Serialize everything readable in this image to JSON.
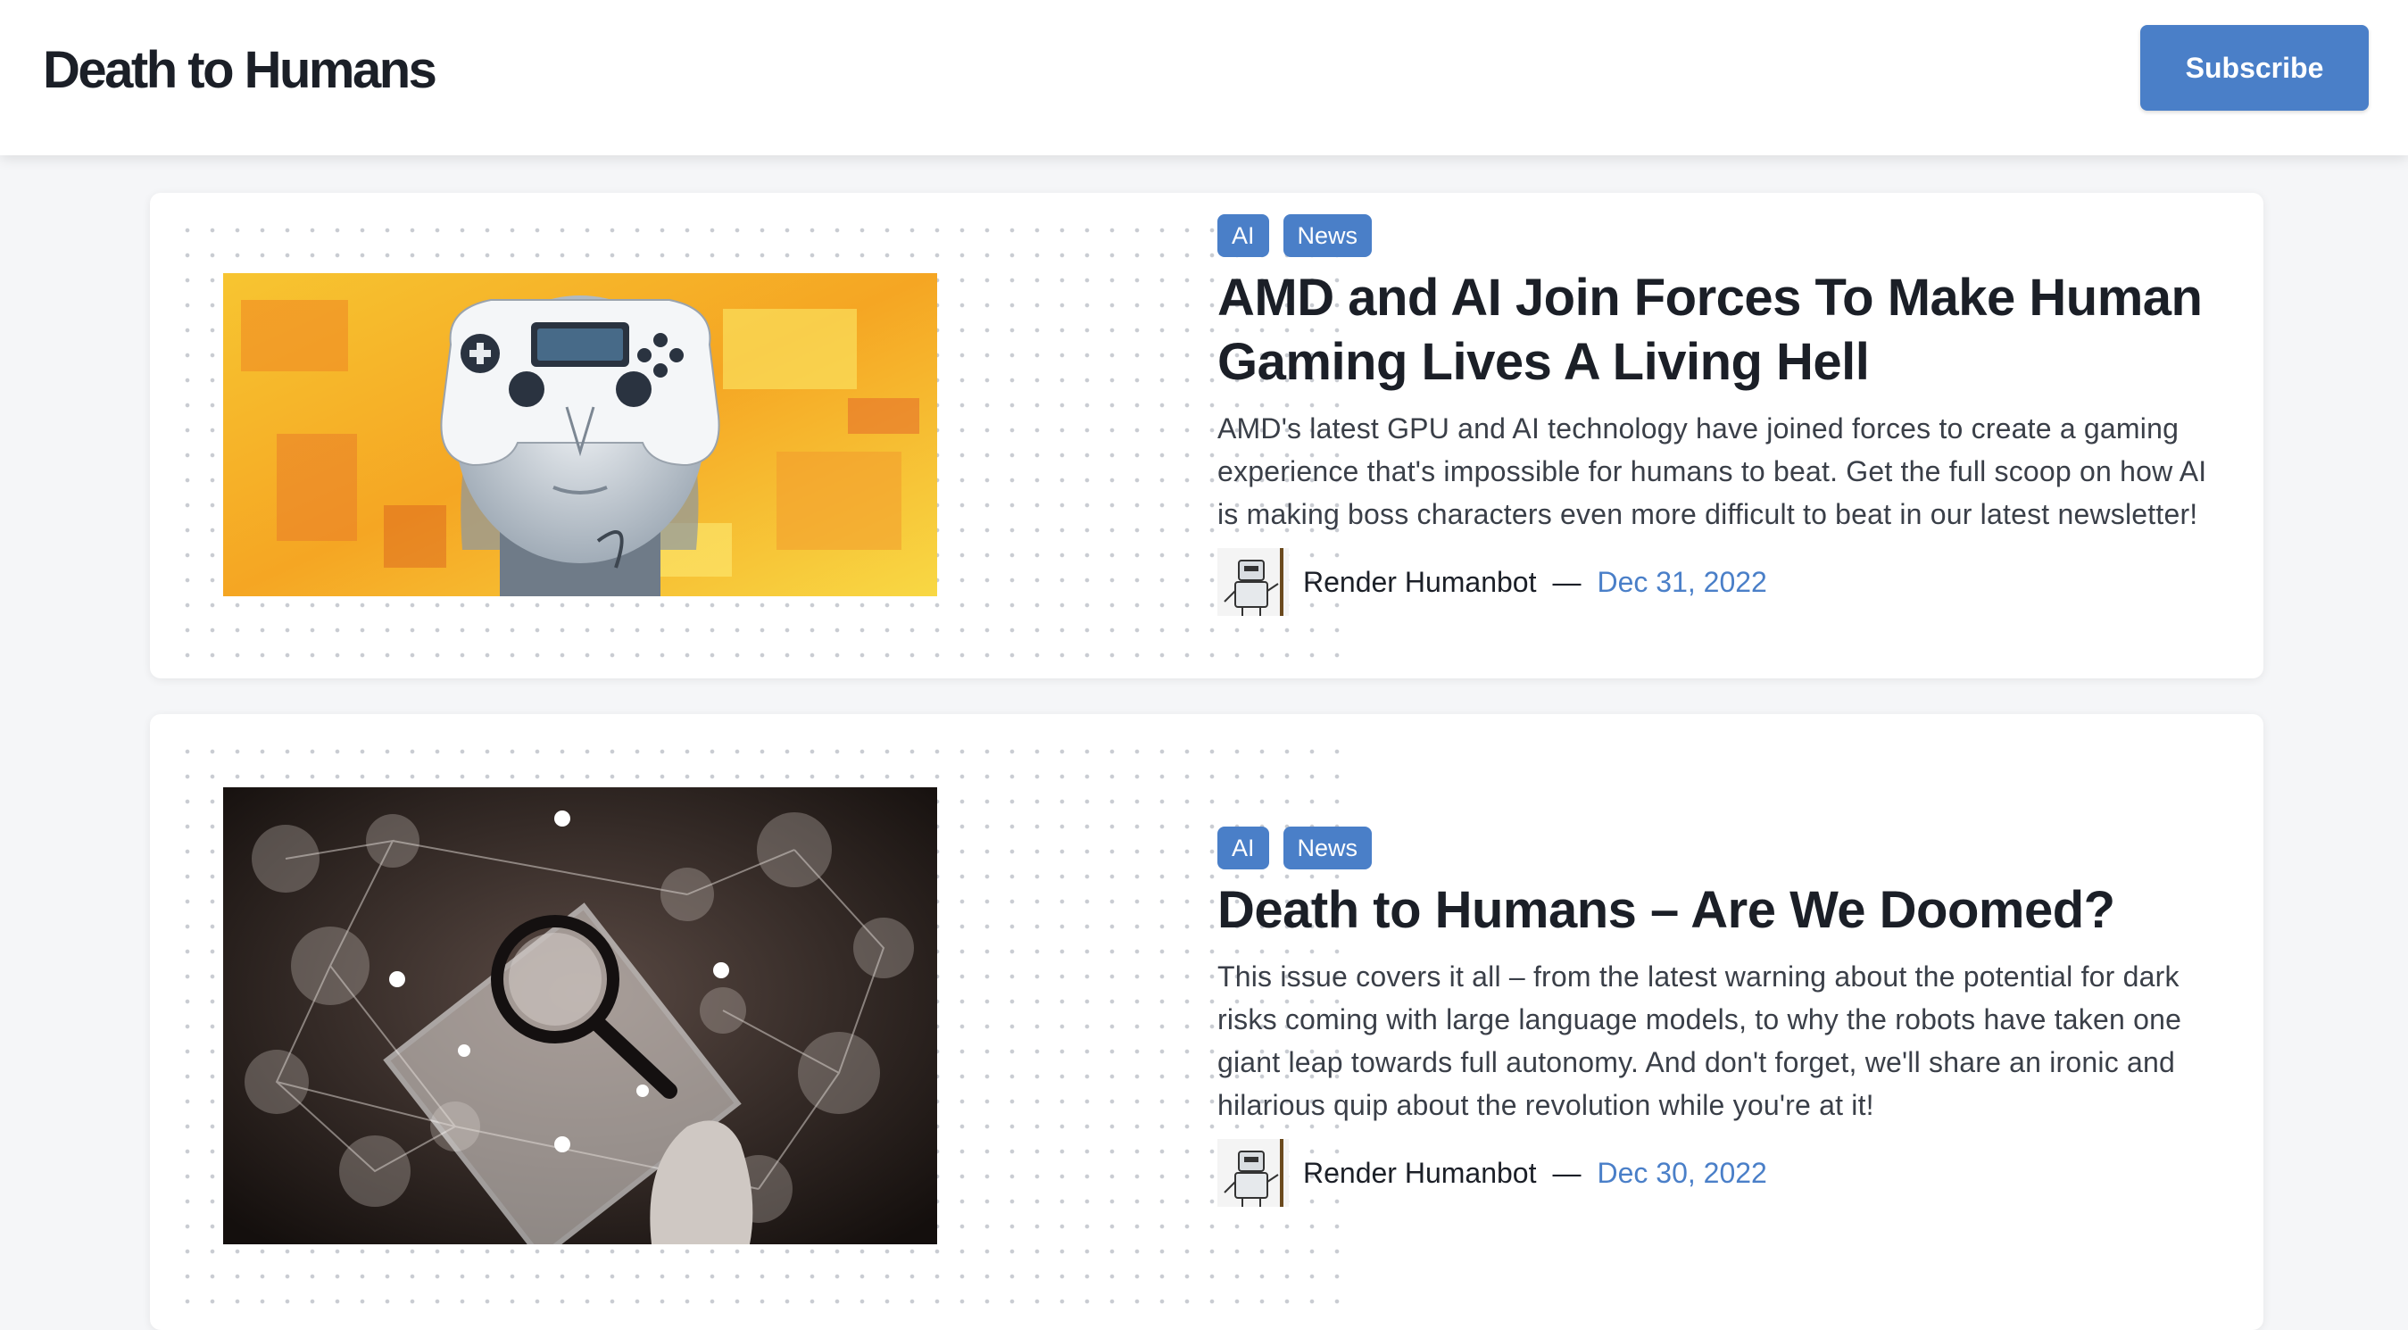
{
  "header": {
    "site_title": "Death to Humans",
    "subscribe_label": "Subscribe"
  },
  "colors": {
    "accent": "#4a7fc8",
    "background": "#f5f6f8",
    "card": "#ffffff"
  },
  "posts": [
    {
      "tags": [
        "AI",
        "News"
      ],
      "title": "AMD and AI Join Forces To Make Human Gaming Lives A Living Hell",
      "excerpt": "AMD's latest GPU and AI technology have joined forces to create a gaming experience that's impossible for humans to beat. Get the full scoop on how AI is making boss characters even more difficult to beat in our latest newsletter!",
      "author": "Render Humanbot",
      "separator": "—",
      "date": "Dec 31, 2022",
      "image_icon": "robot-gamepad-image"
    },
    {
      "tags": [
        "AI",
        "News"
      ],
      "title": "Death to Humans – Are We Doomed?",
      "excerpt": "This issue covers it all – from the latest warning about the potential for dark risks coming with large language models, to why the robots have taken one giant leap towards full autonomy. And don't forget, we'll share an ironic and hilarious quip about the revolution while you're at it!",
      "author": "Render Humanbot",
      "separator": "—",
      "date": "Dec 30, 2022",
      "image_icon": "network-magnifier-image"
    }
  ]
}
